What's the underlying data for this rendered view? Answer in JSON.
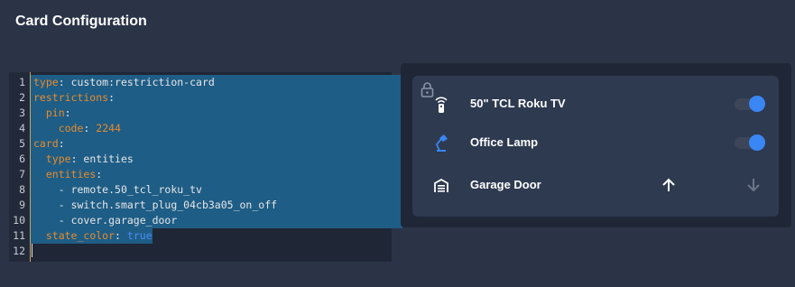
{
  "page": {
    "title": "Card Configuration"
  },
  "editor": {
    "line_numbers": [
      "1",
      "2",
      "3",
      "4",
      "5",
      "6",
      "7",
      "8",
      "9",
      "10",
      "11",
      "12"
    ],
    "lines": [
      {
        "key": "type",
        "sep": ": ",
        "value": "custom:restriction-card",
        "indent": ""
      },
      {
        "key": "restrictions",
        "sep": ":",
        "value": "",
        "indent": ""
      },
      {
        "key": "pin",
        "sep": ":",
        "value": "",
        "indent": "  "
      },
      {
        "key": "code",
        "sep": ": ",
        "value": "2244",
        "indent": "    "
      },
      {
        "key": "card",
        "sep": ":",
        "value": "",
        "indent": ""
      },
      {
        "key": "type",
        "sep": ": ",
        "value": "entities",
        "indent": "  "
      },
      {
        "key": "entities",
        "sep": ":",
        "value": "",
        "indent": "  "
      },
      {
        "key": "",
        "sep": "- ",
        "value": "remote.50_tcl_roku_tv",
        "indent": "    "
      },
      {
        "key": "",
        "sep": "- ",
        "value": "switch.smart_plug_04cb3a05_on_off",
        "indent": "    "
      },
      {
        "key": "",
        "sep": "- ",
        "value": "cover.garage_door",
        "indent": "    "
      },
      {
        "key": "state_color",
        "sep": ": ",
        "value": "true",
        "indent": "  "
      },
      {
        "key": "",
        "sep": "",
        "value": "",
        "indent": ""
      }
    ]
  },
  "preview": {
    "lock_icon": "lock-outline-icon",
    "entities": [
      {
        "name": "50\" TCL Roku TV",
        "icon": "remote-icon",
        "icon_color": "#ffffff",
        "toggle_on": true
      },
      {
        "name": "Office Lamp",
        "icon": "desk-lamp-icon",
        "icon_color": "#3a86f4",
        "toggle_on": true
      },
      {
        "name": "Garage Door",
        "icon": "garage-icon",
        "icon_color": "#ffffff",
        "open_button": "arrow-up-icon",
        "close_button": "arrow-down-icon"
      }
    ],
    "colors": {
      "accent": "#3a86f4",
      "selection": "#1e5d86",
      "yaml_key": "#e88b2c"
    }
  }
}
